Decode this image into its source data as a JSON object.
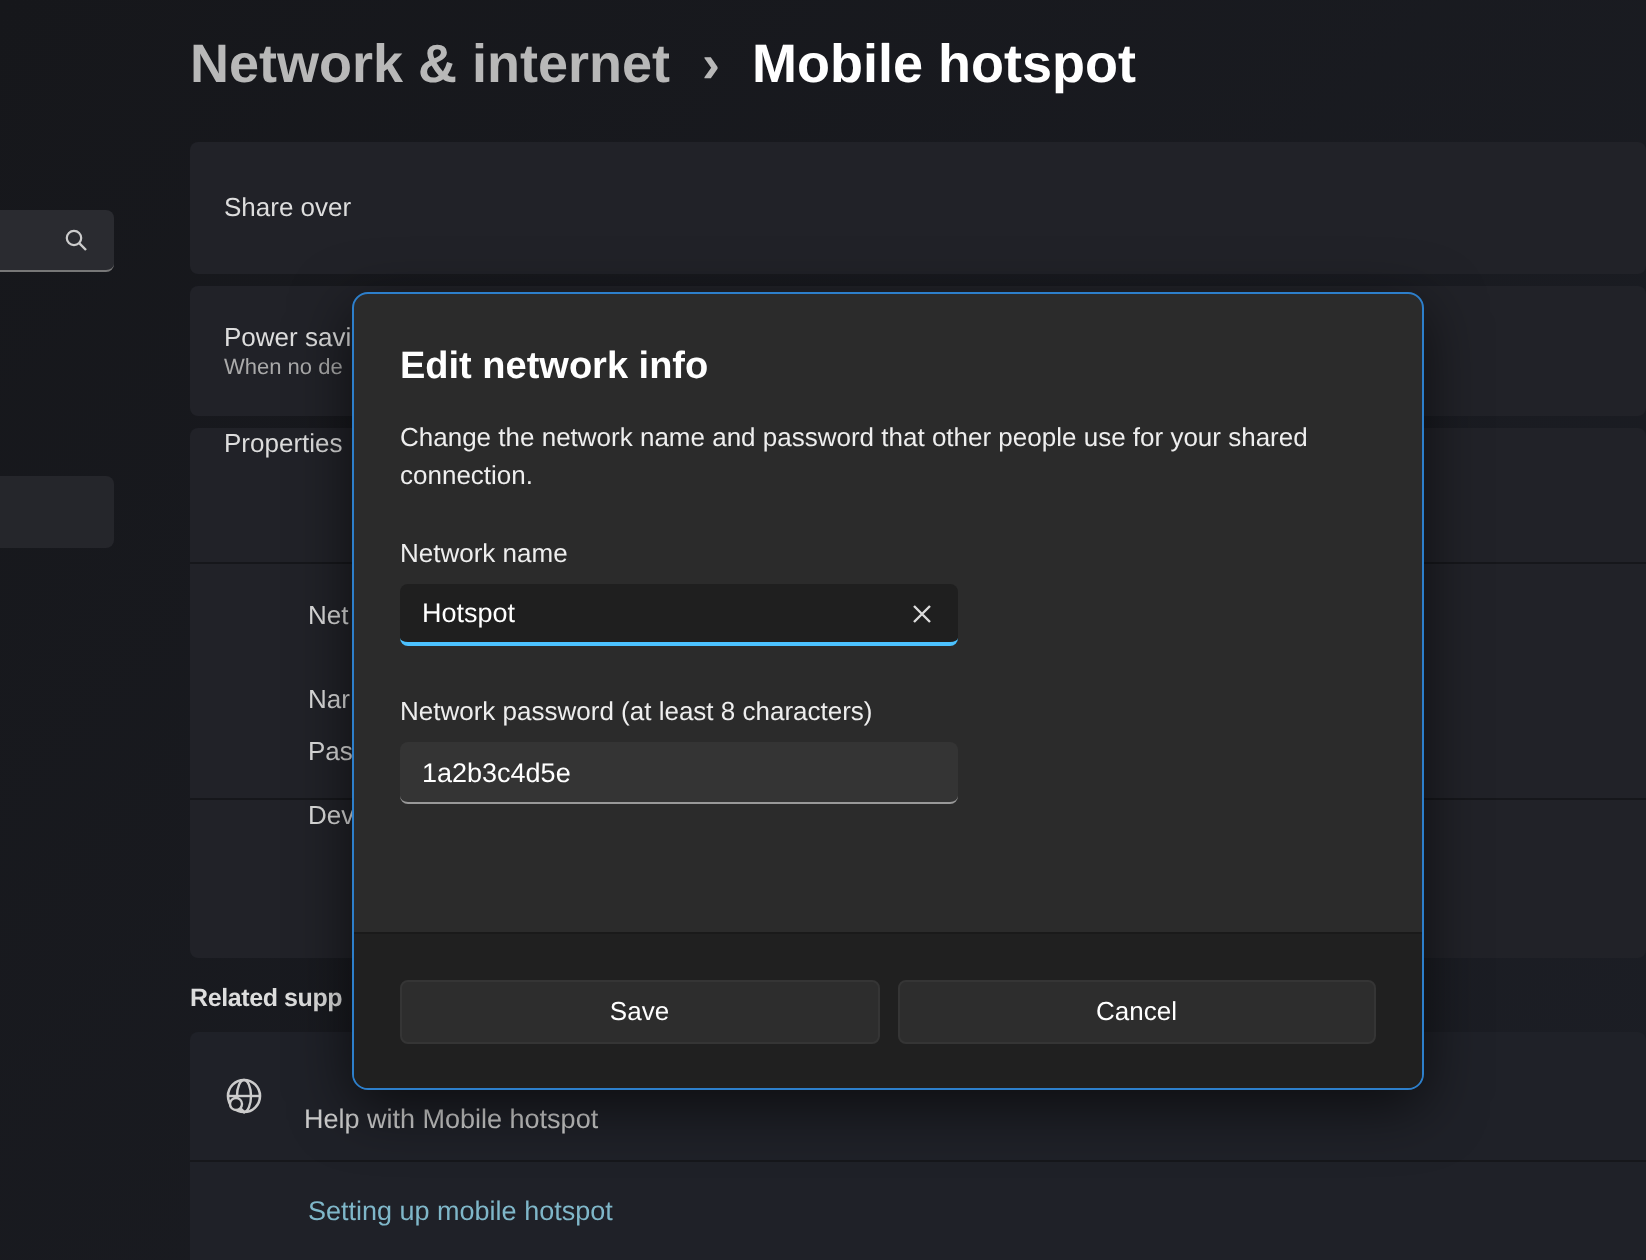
{
  "breadcrumb": {
    "parent": "Network & internet",
    "separator": "›",
    "current": "Mobile hotspot"
  },
  "cards": [
    {
      "title": "Share over"
    },
    {
      "title": "Power savi",
      "subtitle": "When no de"
    },
    {
      "title": "Properties",
      "rows": [
        {
          "label": "Net"
        },
        {
          "label": "Nar"
        },
        {
          "label": "Pas"
        }
      ],
      "footer": "Dev"
    }
  ],
  "related": {
    "heading": "Related supp",
    "help": "Help with Mobile hotspot",
    "link": "Setting up mobile hotspot"
  },
  "dialog": {
    "title": "Edit network info",
    "description": "Change the network name and password that other people use for your shared connection.",
    "fields": [
      {
        "label": "Network name",
        "value": "Hotspot",
        "focused": true
      },
      {
        "label": "Network password (at least 8 characters)",
        "value": "1a2b3c4d5e",
        "focused": false
      }
    ],
    "buttons": [
      "Save",
      "Cancel"
    ]
  }
}
